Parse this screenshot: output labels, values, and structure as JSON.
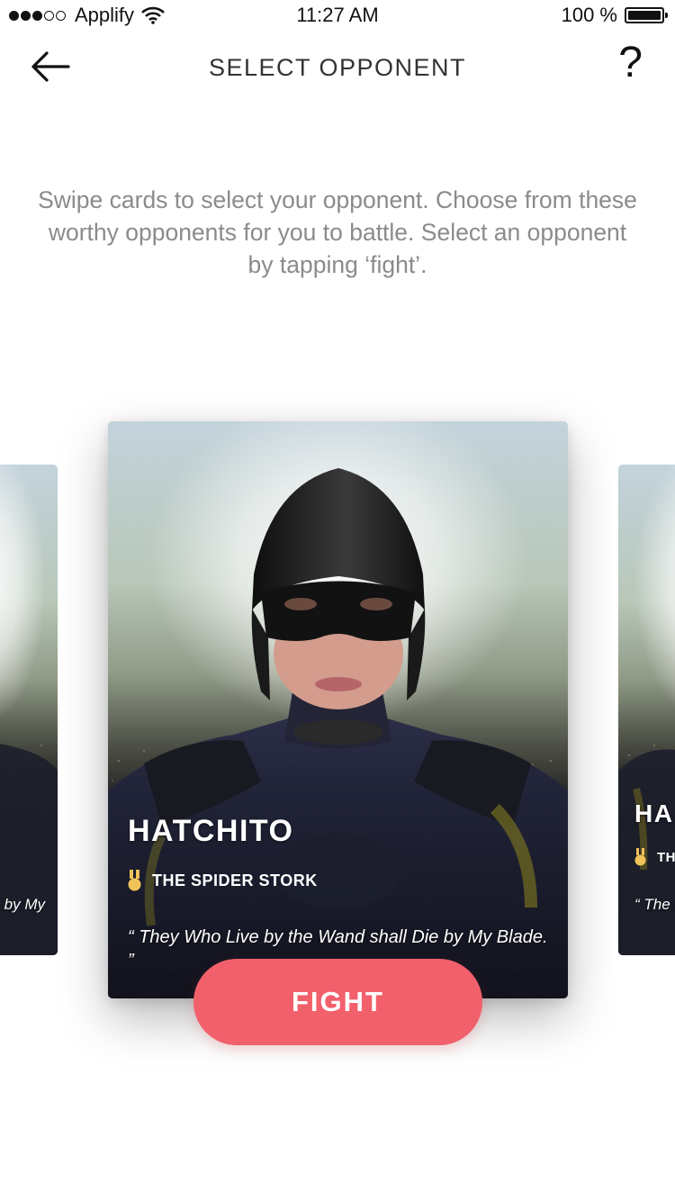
{
  "status_bar": {
    "carrier": "Applify",
    "time": "11:27 AM",
    "battery": "100 %",
    "signal_bars_filled": 3,
    "signal_bars_total": 5,
    "battery_level": 1.0
  },
  "nav": {
    "title": "SELECT OPPONENT",
    "back_icon": "arrow-left-icon",
    "help_label": "?"
  },
  "instructions": "Swipe cards to select your opponent. Choose from these worthy opponents for you to battle. Select an opponent by tapping ‘fight’.",
  "cards": {
    "left": {
      "quote_fragment": "by My"
    },
    "main": {
      "name": "HATCHITO",
      "title": "THE SPIDER STORK",
      "quote": "“ They Who Live by the Wand shall Die by My Blade. ”",
      "medal_icon": "medal-icon"
    },
    "right": {
      "name": "HA",
      "title": "TH",
      "quote": "“ The Blade"
    }
  },
  "fight_button": "FIGHT",
  "colors": {
    "accent": "#f2606c",
    "title_text": "#333333",
    "instruction_text": "#8b8b8b",
    "medal": "#f0c35a"
  }
}
